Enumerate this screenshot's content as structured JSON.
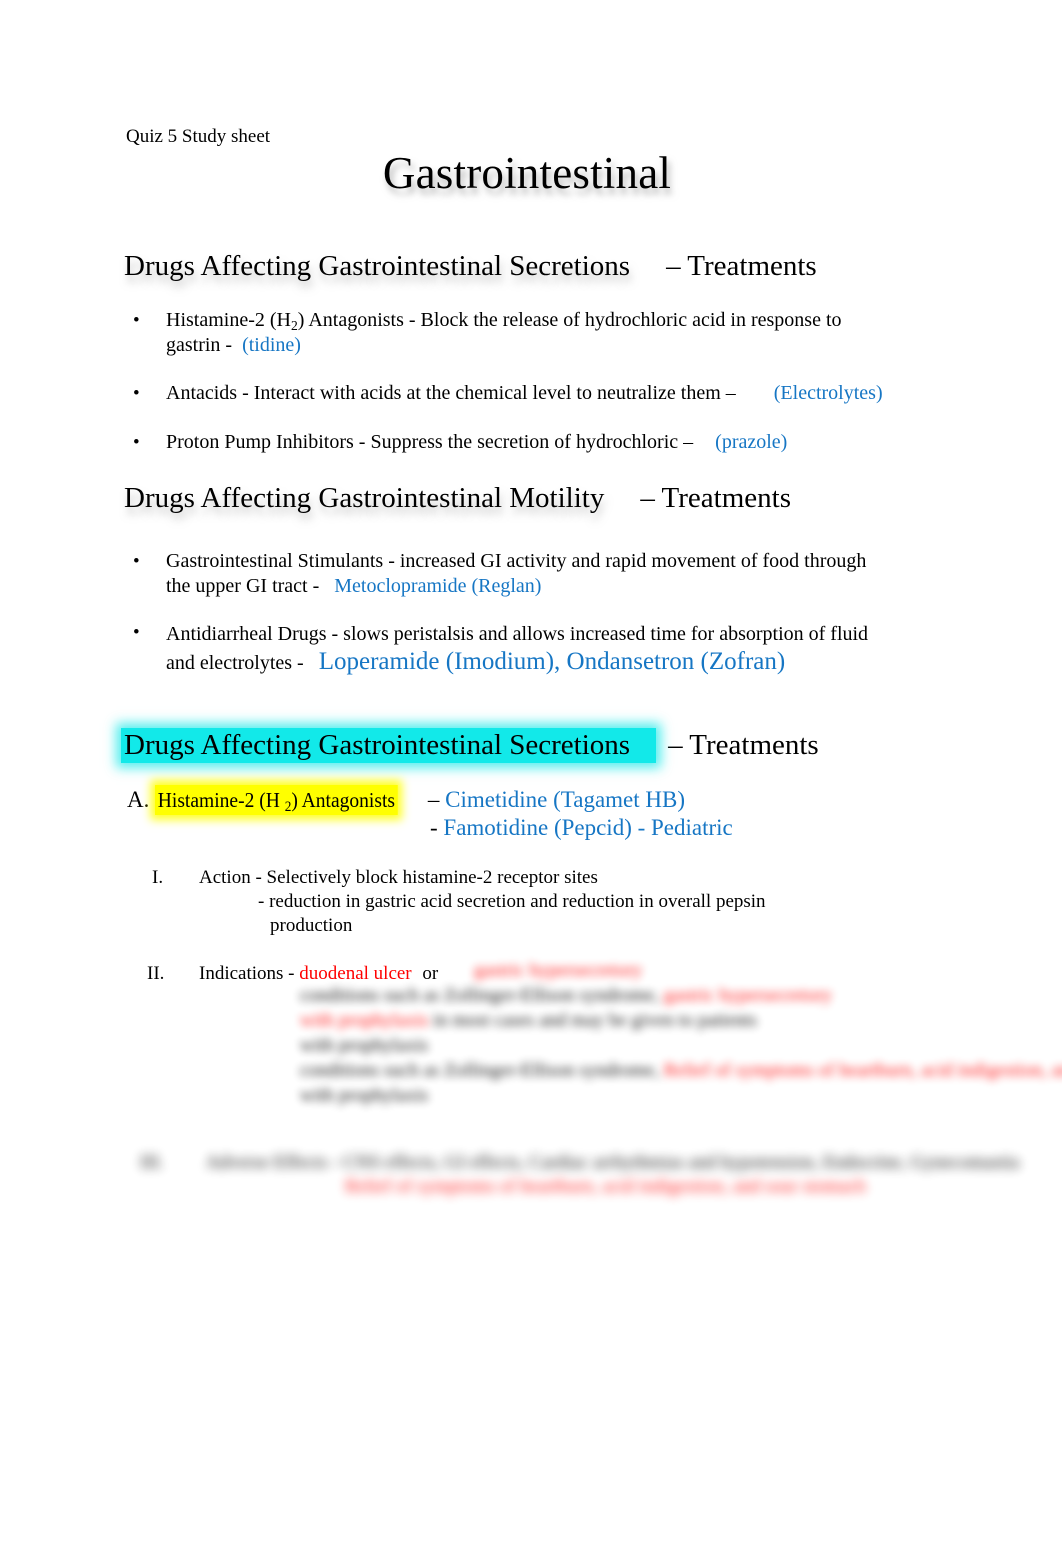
{
  "document": {
    "header_label": "Quiz 5 Study sheet",
    "title": "Gastrointestinal"
  },
  "colors": {
    "blue_drug": "#1676c4",
    "red_text": "#ff0000",
    "cyan_highlight": "#12e9e9",
    "yellow_highlight": "#ffff00",
    "body_text": "#000000"
  },
  "sections": [
    {
      "id": "secretions-overview",
      "heading_main": "Drugs Affecting Gastrointestinal Secretions",
      "heading_tail": "– Treatments",
      "highlight": "none",
      "bullets": [
        {
          "marker": "•",
          "line1": "Histamine-2 (H",
          "sub": "2",
          "line1b": ") Antagonists - Block the release of hydrochloric acid in response to",
          "line2": "gastrin -",
          "accent": "(tidine)"
        },
        {
          "marker": "•",
          "line1": "Antacids - Interact with acids at the chemical level to neutralize them –",
          "accent": "(Electrolytes)"
        },
        {
          "marker": "•",
          "line1": "Proton Pump Inhibitors - Suppress the secretion of hydrochloric –",
          "accent": "(prazole)"
        }
      ]
    },
    {
      "id": "motility-overview",
      "heading_main": "Drugs Affecting Gastrointestinal Motility",
      "heading_tail": "– Treatments",
      "highlight": "none",
      "bullets": [
        {
          "marker": "•",
          "line1": "Gastrointestinal Stimulants - increased GI activity    and rapid movement of food through",
          "line2": "the upper GI tract -",
          "accent": "Metoclopramide   (Reglan)"
        },
        {
          "marker": "•",
          "line1": "Antidiarrheal Drugs - slows peristalsis and allows increased time for absorption of fluid",
          "line2": "and electrolytes -",
          "accent": "Loperamide   (Imodium), Ondansetron   (Zofran)"
        }
      ]
    },
    {
      "id": "secretions-detail",
      "heading_main": "Drugs Affecting Gastrointestinal Secretions",
      "heading_tail": "– Treatments",
      "highlight": "cyan"
    }
  ],
  "drug_class": {
    "marker": "A.",
    "name_prefix": "Histamine-2 (H",
    "name_sub": "2",
    "name_suffix": ") Antagonists",
    "dash": "–",
    "drug_1": "Cimetidine   (Tagamet HB)",
    "drug_2_dash": "-",
    "drug_2": "Famotidine   (Pepcid) - Pediatric",
    "items": [
      {
        "numeral": "I.",
        "text": "Action - Selectively block histamine-2 receptor sites",
        "subline1": "- reduction in gastric acid secretion     and reduction in overall pepsin",
        "subline2": "production",
        "state": "visible"
      },
      {
        "numeral": "II.",
        "label": "Indications -",
        "accent": "duodenal ulcer",
        "trailing": "or",
        "state": "partially-redacted",
        "redacted_note": "blurred text"
      },
      {
        "numeral": "III.",
        "state": "redacted",
        "redacted_note": "blurred text"
      }
    ]
  },
  "redaction": {
    "placeholder_lines": [
      "gastric hypersecretory",
      "conditions such as Zollinger-Ellison syndrome,",
      "in most cases and may be given to patients",
      "with prophylaxis",
      "Relief of symptoms of heartburn, acid indigestion, and sour stomach",
      "with prophylaxis"
    ],
    "line3": "Adverse Effects - CNS effects, GI effects, Cardiac arrhythmias and hypotension, Endocrine, Gynecomastia"
  }
}
